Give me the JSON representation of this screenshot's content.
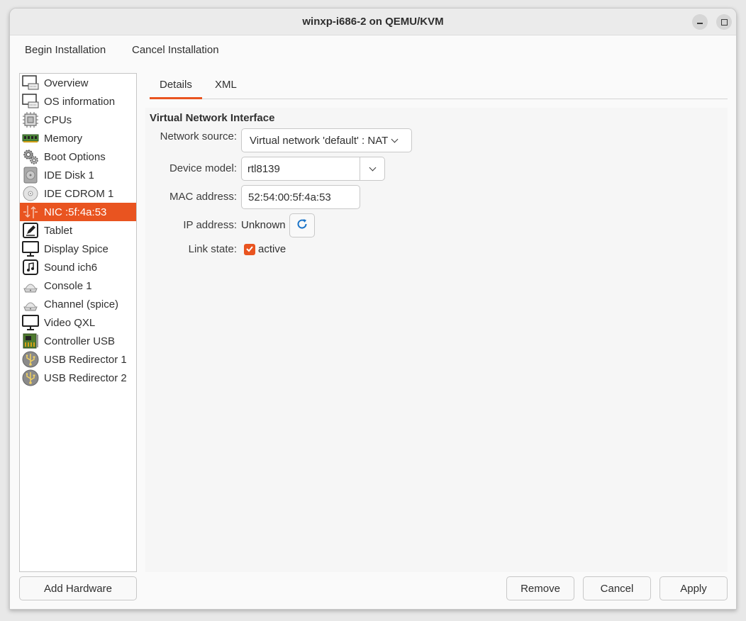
{
  "window": {
    "title": "winxp-i686-2 on QEMU/KVM"
  },
  "toolbar": {
    "begin_label": "Begin Installation",
    "cancel_label": "Cancel Installation"
  },
  "sidebar": {
    "items": [
      {
        "label": "Overview",
        "icon": "monitor-icon"
      },
      {
        "label": "OS information",
        "icon": "monitor-icon"
      },
      {
        "label": "CPUs",
        "icon": "cpu-icon"
      },
      {
        "label": "Memory",
        "icon": "memory-icon"
      },
      {
        "label": "Boot Options",
        "icon": "gear-icon"
      },
      {
        "label": "IDE Disk 1",
        "icon": "disk-icon"
      },
      {
        "label": "IDE CDROM 1",
        "icon": "cdrom-icon"
      },
      {
        "label": "NIC :5f:4a:53",
        "icon": "network-icon",
        "selected": true
      },
      {
        "label": "Tablet",
        "icon": "tablet-icon"
      },
      {
        "label": "Display Spice",
        "icon": "display-icon"
      },
      {
        "label": "Sound ich6",
        "icon": "sound-icon"
      },
      {
        "label": "Console 1",
        "icon": "serial-icon"
      },
      {
        "label": "Channel (spice)",
        "icon": "serial-icon"
      },
      {
        "label": "Video QXL",
        "icon": "display-icon"
      },
      {
        "label": "Controller USB",
        "icon": "controller-icon"
      },
      {
        "label": "USB Redirector 1",
        "icon": "usb-icon"
      },
      {
        "label": "USB Redirector 2",
        "icon": "usb-icon"
      }
    ],
    "add_hardware_label": "Add Hardware"
  },
  "tabs": [
    {
      "label": "Details",
      "active": true
    },
    {
      "label": "XML",
      "active": false
    }
  ],
  "nic": {
    "section_title": "Virtual Network Interface",
    "network_source_label": "Network source:",
    "network_source_value": "Virtual network 'default' : NAT",
    "device_model_label": "Device model:",
    "device_model_value": "rtl8139",
    "mac_label": "MAC address:",
    "mac_value": "52:54:00:5f:4a:53",
    "ip_label": "IP address:",
    "ip_value": "Unknown",
    "link_state_label": "Link state:",
    "link_state_value": "active",
    "link_state_checked": true
  },
  "footer": {
    "remove_label": "Remove",
    "cancel_label": "Cancel",
    "apply_label": "Apply"
  },
  "colors": {
    "accent": "#e95420"
  }
}
